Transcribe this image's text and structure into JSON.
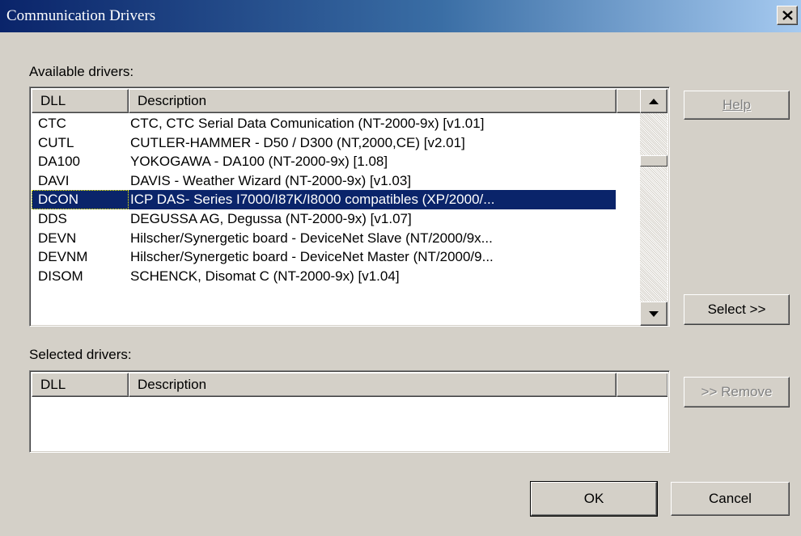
{
  "window": {
    "title": "Communication Drivers",
    "close_glyph": "✕"
  },
  "available": {
    "label": "Available drivers:",
    "columns": {
      "dll": "DLL",
      "description": "Description"
    },
    "rows": [
      {
        "dll": "CTC",
        "description": "CTC,  CTC Serial Data Comunication (NT-2000-9x)  [v1.01]"
      },
      {
        "dll": "CUTL",
        "description": "CUTLER-HAMMER - D50 / D300 (NT,2000,CE) [v2.01]"
      },
      {
        "dll": "DA100",
        "description": "YOKOGAWA - DA100 (NT-2000-9x) [1.08]"
      },
      {
        "dll": "DAVI",
        "description": "DAVIS - Weather Wizard (NT-2000-9x) [v1.03]"
      },
      {
        "dll": "DCON",
        "description": "ICP DAS- Series I7000/I87K/I8000 compatibles (XP/2000/..."
      },
      {
        "dll": "DDS",
        "description": "DEGUSSA AG, Degussa (NT-2000-9x) [v1.07]"
      },
      {
        "dll": "DEVN",
        "description": "Hilscher/Synergetic board - DeviceNet Slave (NT/2000/9x..."
      },
      {
        "dll": "DEVNM",
        "description": "Hilscher/Synergetic board - DeviceNet Master (NT/2000/9..."
      },
      {
        "dll": "DISOM",
        "description": "SCHENCK, Disomat C (NT-2000-9x) [v1.04]"
      }
    ],
    "selected_row": "DCON",
    "scroll_up_icon": "scroll-up-arrow",
    "scroll_down_icon": "scroll-down-arrow"
  },
  "selected": {
    "label": "Selected drivers:",
    "columns": {
      "dll": "DLL",
      "description": "Description"
    },
    "rows": []
  },
  "buttons": {
    "help": "Help",
    "select": "Select >>",
    "remove": ">> Remove",
    "ok": "OK",
    "cancel": "Cancel"
  },
  "colors": {
    "titlebar_start": "#0a246a",
    "titlebar_end": "#a6caf0",
    "face": "#d4d0c8",
    "selection": "#0a246a"
  }
}
